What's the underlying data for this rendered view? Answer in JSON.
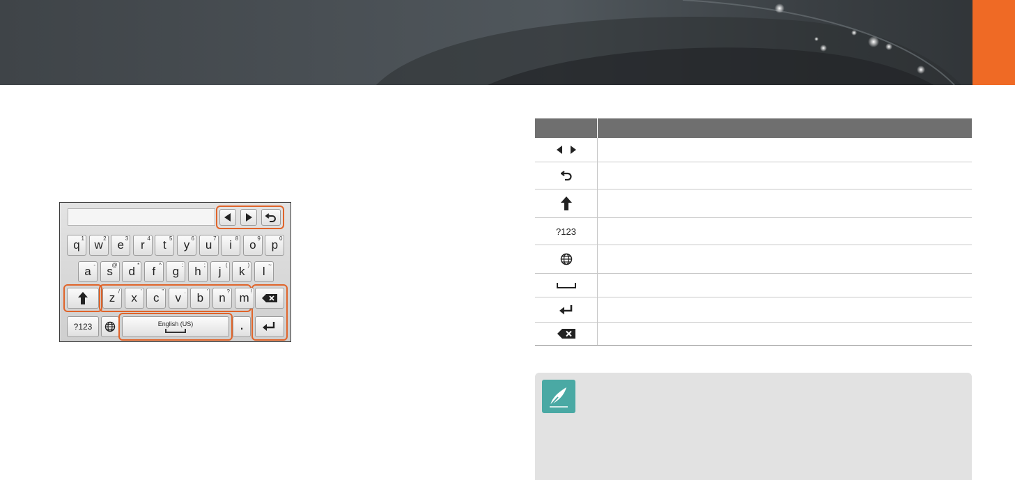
{
  "header": {
    "accent_color": "#ef6a25"
  },
  "keyboard": {
    "row1": [
      {
        "key": "q",
        "sup": "1"
      },
      {
        "key": "w",
        "sup": "2"
      },
      {
        "key": "e",
        "sup": "3"
      },
      {
        "key": "r",
        "sup": "4"
      },
      {
        "key": "t",
        "sup": "5"
      },
      {
        "key": "y",
        "sup": "6"
      },
      {
        "key": "u",
        "sup": "7"
      },
      {
        "key": "i",
        "sup": "8"
      },
      {
        "key": "o",
        "sup": "9"
      },
      {
        "key": "p",
        "sup": "0"
      }
    ],
    "row2": [
      {
        "key": "a",
        "sup": "-"
      },
      {
        "key": "s",
        "sup": "@"
      },
      {
        "key": "d",
        "sup": "*"
      },
      {
        "key": "f",
        "sup": "^"
      },
      {
        "key": "g",
        "sup": ":"
      },
      {
        "key": "h",
        "sup": ";"
      },
      {
        "key": "j",
        "sup": "("
      },
      {
        "key": "k",
        "sup": ")"
      },
      {
        "key": "l",
        "sup": "~"
      }
    ],
    "row3": [
      {
        "key": "z",
        "sup": "/"
      },
      {
        "key": "x",
        "sup": "'"
      },
      {
        "key": "c",
        "sup": "\""
      },
      {
        "key": "v",
        "sup": "."
      },
      {
        "key": "b",
        "sup": "'"
      },
      {
        "key": "n",
        "sup": "?"
      },
      {
        "key": "m",
        "sup": "!"
      }
    ],
    "numeric_key": "?123",
    "space_label": "English (US)",
    "period_key": ".",
    "highlight_color": "#e0642a"
  },
  "table": {
    "rows": [
      {
        "icon": "left-right-arrow-icons",
        "text": ""
      },
      {
        "icon": "undo-icon",
        "text": ""
      },
      {
        "icon": "shift-arrow-icon",
        "text": ""
      },
      {
        "icon": "",
        "text": "?123"
      },
      {
        "icon": "globe-icon",
        "text": ""
      },
      {
        "icon": "space-bar-icon",
        "text": ""
      },
      {
        "icon": "enter-icon",
        "text": ""
      },
      {
        "icon": "backspace-icon",
        "text": ""
      }
    ]
  },
  "note": {
    "icon": "pen-note-icon",
    "icon_color": "#4aa9a4"
  }
}
